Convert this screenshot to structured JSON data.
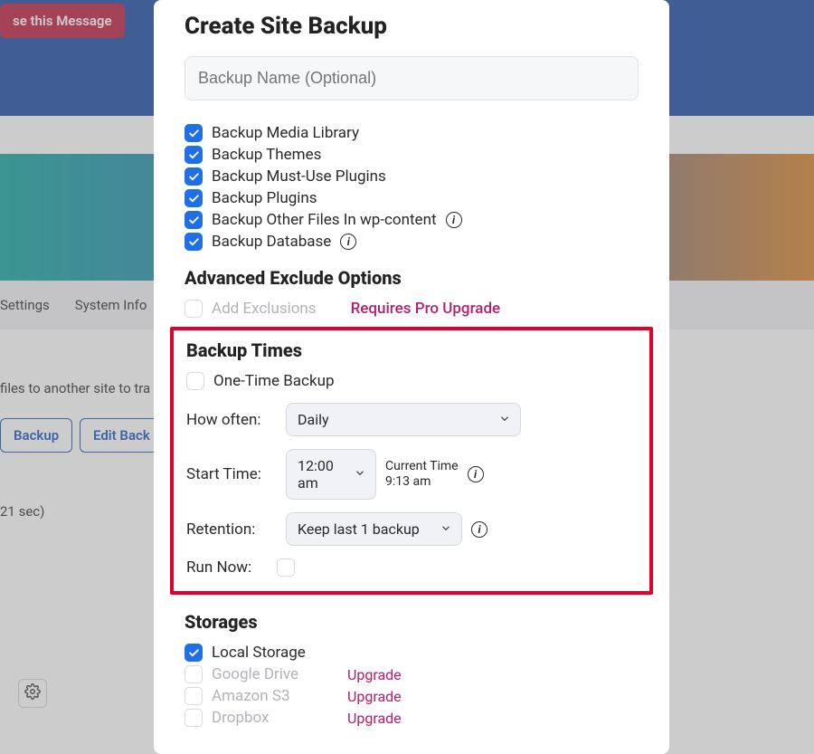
{
  "background": {
    "pill_message": "se this Message",
    "nav_settings": "Settings",
    "nav_system_info": "System Info",
    "transfer_text": "files to another site to tra",
    "btn_backup": "Backup",
    "btn_edit": "Edit Back",
    "stat_line": "21 sec)"
  },
  "modal": {
    "title": "Create Site Backup",
    "name_placeholder": "Backup Name (Optional)",
    "options": [
      "Backup Media Library",
      "Backup Themes",
      "Backup Must-Use Plugins",
      "Backup Plugins",
      "Backup Other Files In wp-content",
      "Backup Database"
    ],
    "advanced_heading": "Advanced Exclude Options",
    "add_exclusions": "Add Exclusions",
    "requires_pro": "Requires Pro Upgrade",
    "backup_times_heading": "Backup Times",
    "one_time_backup": "One-Time Backup",
    "how_often_label": "How often:",
    "how_often_value": "Daily",
    "start_time_label": "Start Time:",
    "start_time_value": "12:00 am",
    "current_time_label": "Current Time",
    "current_time_value": "9:13 am",
    "retention_label": "Retention:",
    "retention_value": "Keep last 1 backup",
    "run_now_label": "Run Now:",
    "storages_heading": "Storages",
    "storages": [
      {
        "label": "Local Storage",
        "checked": true,
        "upgrade": false
      },
      {
        "label": "Google Drive",
        "checked": false,
        "upgrade": true
      },
      {
        "label": "Amazon S3",
        "checked": false,
        "upgrade": true
      },
      {
        "label": "Dropbox",
        "checked": false,
        "upgrade": true
      }
    ],
    "upgrade_text": "Upgrade"
  }
}
